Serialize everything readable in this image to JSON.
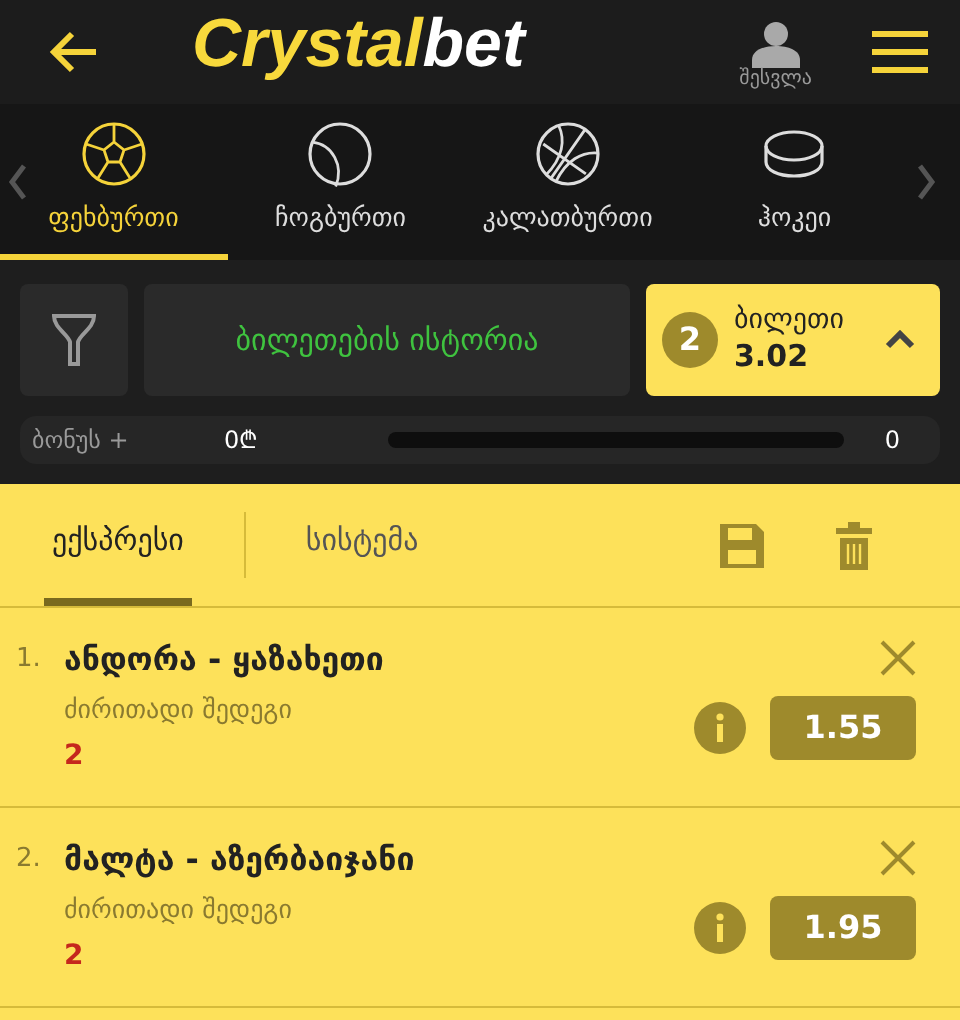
{
  "header": {
    "logo_left": "Crystal",
    "logo_right": "bet",
    "login": "შესვლა"
  },
  "sports": [
    {
      "label": "ფეხბურთი",
      "selected": true,
      "kind": "football"
    },
    {
      "label": "ჩოგბურთი",
      "selected": false,
      "kind": "tennis"
    },
    {
      "label": "კალათბურთი",
      "selected": false,
      "kind": "basketball"
    },
    {
      "label": "ჰოკეი",
      "selected": false,
      "kind": "hockey"
    }
  ],
  "history_button": "ბილეთების ისტორია",
  "ticket": {
    "count": "2",
    "label": "ბილეთი",
    "odds": "3.02"
  },
  "bonus": {
    "label": "ბონუს +",
    "amount": "0₾",
    "value": "0"
  },
  "bet_tabs": [
    {
      "label": "ექსპრესი",
      "selected": true
    },
    {
      "label": "სისტემა",
      "selected": false
    }
  ],
  "bets": [
    {
      "number": "1.",
      "match": "ანდორა - ყაზახეთი",
      "market": "ძირითადი შედეგი",
      "pick": "2",
      "odds": "1.55"
    },
    {
      "number": "2.",
      "match": "მალტა - აზერბაიჯანი",
      "market": "ძირითადი შედეგი",
      "pick": "2",
      "odds": "1.95"
    }
  ]
}
